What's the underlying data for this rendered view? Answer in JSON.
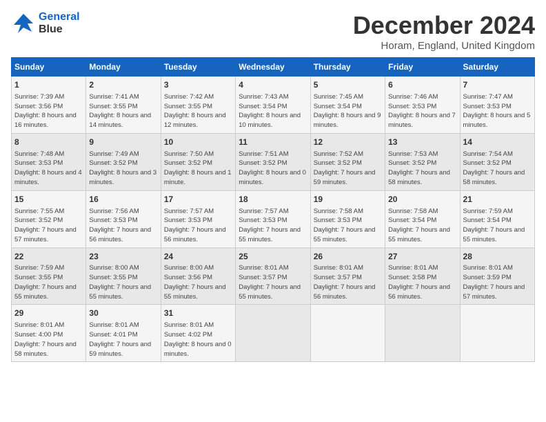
{
  "logo": {
    "line1": "General",
    "line2": "Blue"
  },
  "title": "December 2024",
  "subtitle": "Horam, England, United Kingdom",
  "days_of_week": [
    "Sunday",
    "Monday",
    "Tuesday",
    "Wednesday",
    "Thursday",
    "Friday",
    "Saturday"
  ],
  "weeks": [
    [
      {
        "day": "1",
        "content": "Sunrise: 7:39 AM\nSunset: 3:56 PM\nDaylight: 8 hours and 16 minutes."
      },
      {
        "day": "2",
        "content": "Sunrise: 7:41 AM\nSunset: 3:55 PM\nDaylight: 8 hours and 14 minutes."
      },
      {
        "day": "3",
        "content": "Sunrise: 7:42 AM\nSunset: 3:55 PM\nDaylight: 8 hours and 12 minutes."
      },
      {
        "day": "4",
        "content": "Sunrise: 7:43 AM\nSunset: 3:54 PM\nDaylight: 8 hours and 10 minutes."
      },
      {
        "day": "5",
        "content": "Sunrise: 7:45 AM\nSunset: 3:54 PM\nDaylight: 8 hours and 9 minutes."
      },
      {
        "day": "6",
        "content": "Sunrise: 7:46 AM\nSunset: 3:53 PM\nDaylight: 8 hours and 7 minutes."
      },
      {
        "day": "7",
        "content": "Sunrise: 7:47 AM\nSunset: 3:53 PM\nDaylight: 8 hours and 5 minutes."
      }
    ],
    [
      {
        "day": "8",
        "content": "Sunrise: 7:48 AM\nSunset: 3:53 PM\nDaylight: 8 hours and 4 minutes."
      },
      {
        "day": "9",
        "content": "Sunrise: 7:49 AM\nSunset: 3:52 PM\nDaylight: 8 hours and 3 minutes."
      },
      {
        "day": "10",
        "content": "Sunrise: 7:50 AM\nSunset: 3:52 PM\nDaylight: 8 hours and 1 minute."
      },
      {
        "day": "11",
        "content": "Sunrise: 7:51 AM\nSunset: 3:52 PM\nDaylight: 8 hours and 0 minutes."
      },
      {
        "day": "12",
        "content": "Sunrise: 7:52 AM\nSunset: 3:52 PM\nDaylight: 7 hours and 59 minutes."
      },
      {
        "day": "13",
        "content": "Sunrise: 7:53 AM\nSunset: 3:52 PM\nDaylight: 7 hours and 58 minutes."
      },
      {
        "day": "14",
        "content": "Sunrise: 7:54 AM\nSunset: 3:52 PM\nDaylight: 7 hours and 58 minutes."
      }
    ],
    [
      {
        "day": "15",
        "content": "Sunrise: 7:55 AM\nSunset: 3:52 PM\nDaylight: 7 hours and 57 minutes."
      },
      {
        "day": "16",
        "content": "Sunrise: 7:56 AM\nSunset: 3:53 PM\nDaylight: 7 hours and 56 minutes."
      },
      {
        "day": "17",
        "content": "Sunrise: 7:57 AM\nSunset: 3:53 PM\nDaylight: 7 hours and 56 minutes."
      },
      {
        "day": "18",
        "content": "Sunrise: 7:57 AM\nSunset: 3:53 PM\nDaylight: 7 hours and 55 minutes."
      },
      {
        "day": "19",
        "content": "Sunrise: 7:58 AM\nSunset: 3:53 PM\nDaylight: 7 hours and 55 minutes."
      },
      {
        "day": "20",
        "content": "Sunrise: 7:58 AM\nSunset: 3:54 PM\nDaylight: 7 hours and 55 minutes."
      },
      {
        "day": "21",
        "content": "Sunrise: 7:59 AM\nSunset: 3:54 PM\nDaylight: 7 hours and 55 minutes."
      }
    ],
    [
      {
        "day": "22",
        "content": "Sunrise: 7:59 AM\nSunset: 3:55 PM\nDaylight: 7 hours and 55 minutes."
      },
      {
        "day": "23",
        "content": "Sunrise: 8:00 AM\nSunset: 3:55 PM\nDaylight: 7 hours and 55 minutes."
      },
      {
        "day": "24",
        "content": "Sunrise: 8:00 AM\nSunset: 3:56 PM\nDaylight: 7 hours and 55 minutes."
      },
      {
        "day": "25",
        "content": "Sunrise: 8:01 AM\nSunset: 3:57 PM\nDaylight: 7 hours and 55 minutes."
      },
      {
        "day": "26",
        "content": "Sunrise: 8:01 AM\nSunset: 3:57 PM\nDaylight: 7 hours and 56 minutes."
      },
      {
        "day": "27",
        "content": "Sunrise: 8:01 AM\nSunset: 3:58 PM\nDaylight: 7 hours and 56 minutes."
      },
      {
        "day": "28",
        "content": "Sunrise: 8:01 AM\nSunset: 3:59 PM\nDaylight: 7 hours and 57 minutes."
      }
    ],
    [
      {
        "day": "29",
        "content": "Sunrise: 8:01 AM\nSunset: 4:00 PM\nDaylight: 7 hours and 58 minutes."
      },
      {
        "day": "30",
        "content": "Sunrise: 8:01 AM\nSunset: 4:01 PM\nDaylight: 7 hours and 59 minutes."
      },
      {
        "day": "31",
        "content": "Sunrise: 8:01 AM\nSunset: 4:02 PM\nDaylight: 8 hours and 0 minutes."
      },
      {
        "day": "",
        "content": ""
      },
      {
        "day": "",
        "content": ""
      },
      {
        "day": "",
        "content": ""
      },
      {
        "day": "",
        "content": ""
      }
    ]
  ]
}
